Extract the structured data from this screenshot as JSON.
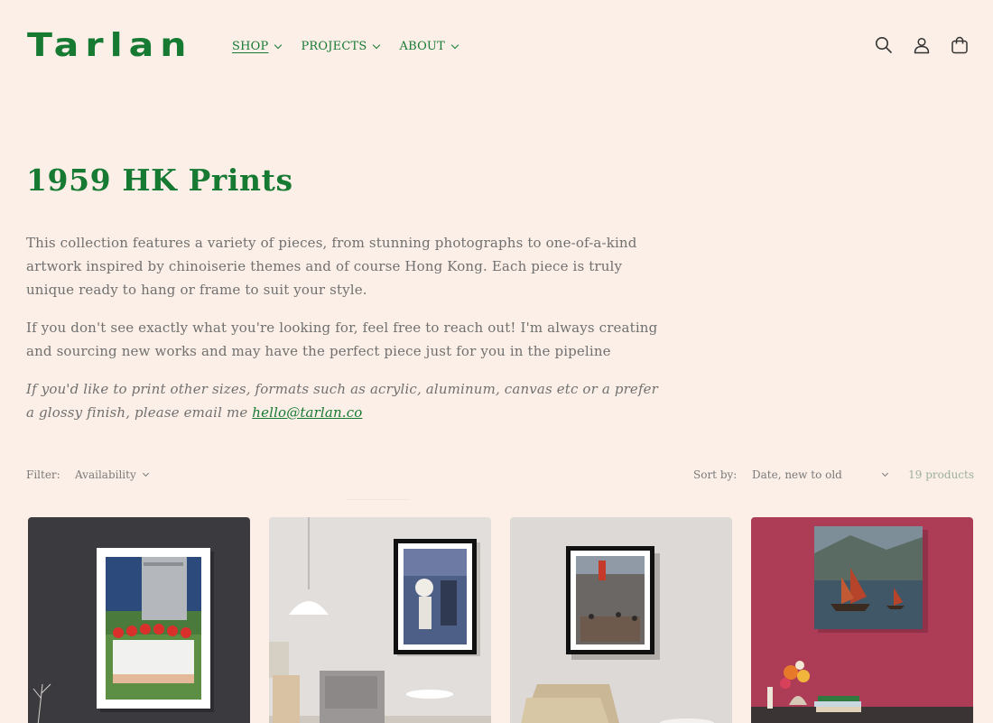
{
  "brand": {
    "logo_text": "Tarlan"
  },
  "nav": [
    {
      "label": "SHOP",
      "active": true
    },
    {
      "label": "PROJECTS",
      "active": false
    },
    {
      "label": "ABOUT",
      "active": false
    }
  ],
  "header_icons": [
    "search-icon",
    "account-icon",
    "cart-icon"
  ],
  "collection": {
    "title": "1959 HK Prints",
    "paragraph_1": "This collection features a variety of pieces, from stunning photographs to one-of-a-kind artwork inspired by chinoiserie themes and of course Hong Kong. Each piece is truly unique ready to hang or frame to suit your style.",
    "paragraph_2": "If you don't see exactly what you're looking for, feel free to reach out! I'm always creating and sourcing new works and may have the perfect piece just for you in the pipeline",
    "paragraph_3_prefix": "If you'd like to print other sizes, formats such as acrylic, aluminum, canvas etc or a prefer a glossy finish, please email me ",
    "email": "hello@tarlan.co"
  },
  "filters": {
    "filter_label": "Filter:",
    "availability_label": "Availability",
    "sort_label": "Sort by:",
    "sort_value": "Date, new to old",
    "product_count": "19 products"
  },
  "colors": {
    "brand_green": "#177a33",
    "background": "#fcefe7",
    "body_text": "#707070"
  }
}
